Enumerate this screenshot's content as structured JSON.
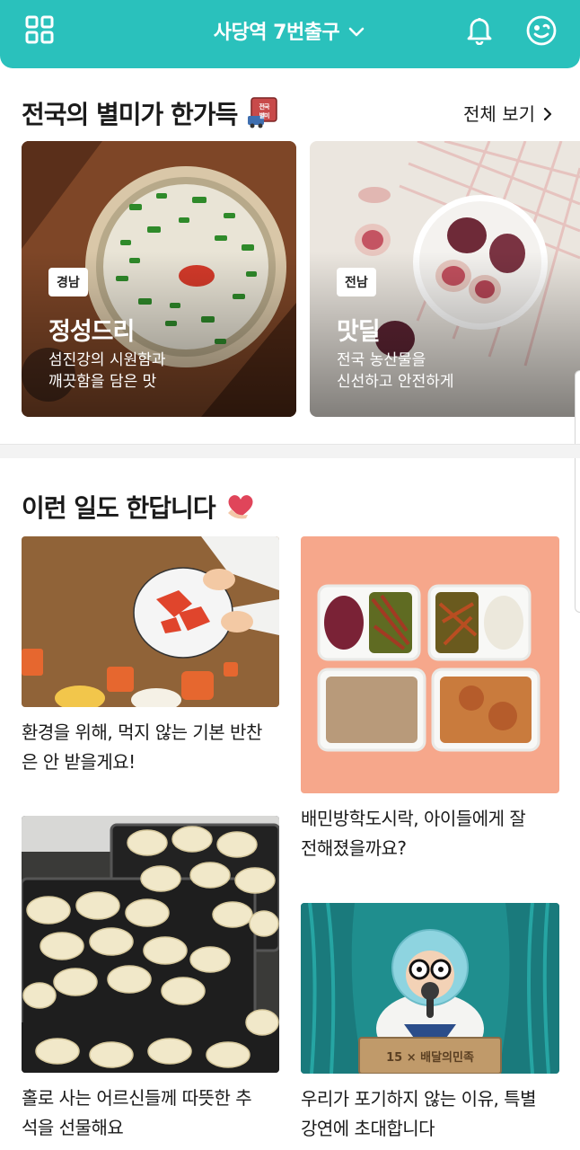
{
  "header": {
    "location": "사당역 7번출구",
    "menu_icon": "grid-menu-icon",
    "bell_icon": "bell-icon",
    "profile_icon": "smile-face-icon",
    "brand_color": "#2ac1bc"
  },
  "regional": {
    "title": "전국의 별미가 한가득",
    "see_all": "전체 보기",
    "stamp_text": "전국별미",
    "cards": [
      {
        "region": "경남",
        "name": "정성드리",
        "desc_line1": "섬진강의 시원함과",
        "desc_line2": "깨끗함을 담은 맛"
      },
      {
        "region": "전남",
        "name": "맛딜",
        "desc_line1": "전국 농산물을",
        "desc_line2": "신선하고 안전하게"
      }
    ]
  },
  "stories": {
    "title": "이런 일도 한답니다",
    "items": [
      {
        "caption_line1": "환경을 위해, 먹지 않는 기본 반찬",
        "caption_line2": "은 안 받을게요!"
      },
      {
        "caption_line1": "배민방학도시락, 아이들에게 잘",
        "caption_line2": "전해졌을까요?"
      },
      {
        "caption_line1": "홀로 사는 어르신들께 따뜻한 추",
        "caption_line2": "석을 선물해요"
      },
      {
        "caption_line1": "우리가 포기하지 않는 이유, 특별",
        "caption_line2": "강연에 초대합니다",
        "sign_text": "15 × 배달의민족"
      }
    ]
  }
}
